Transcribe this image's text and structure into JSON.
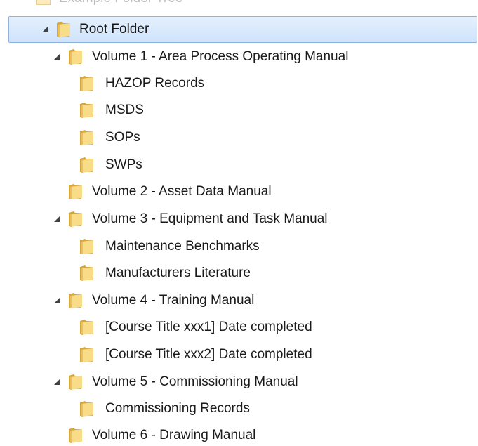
{
  "tree": {
    "partial_top_label": "Example Folder Tree",
    "root": {
      "label": "Root Folder",
      "expanded": true,
      "selected": true
    },
    "nodes": [
      {
        "label": "Volume 1 - Area Process Operating Manual",
        "depth": 1,
        "expanded": true
      },
      {
        "label": "HAZOP Records",
        "depth": 2
      },
      {
        "label": "MSDS",
        "depth": 2
      },
      {
        "label": "SOPs",
        "depth": 2
      },
      {
        "label": "SWPs",
        "depth": 2
      },
      {
        "label": "Volume 2 - Asset Data Manual",
        "depth": 1
      },
      {
        "label": "Volume 3 - Equipment and Task Manual",
        "depth": 1,
        "expanded": true
      },
      {
        "label": "Maintenance Benchmarks",
        "depth": 2
      },
      {
        "label": "Manufacturers Literature",
        "depth": 2
      },
      {
        "label": "Volume 4 - Training Manual",
        "depth": 1,
        "expanded": true
      },
      {
        "label": "[Course Title xxx1] Date completed",
        "depth": 2
      },
      {
        "label": "[Course Title xxx2] Date completed",
        "depth": 2
      },
      {
        "label": "Volume 5 - Commissioning Manual",
        "depth": 1,
        "expanded": true
      },
      {
        "label": "Commissioning Records",
        "depth": 2
      },
      {
        "label": "Volume 6 - Drawing Manual",
        "depth": 1
      }
    ]
  },
  "icons": {
    "folder": "folder-icon",
    "expander": "expanded-triangle-icon"
  },
  "colors": {
    "selection_bg": "#cfe3fb",
    "selection_border": "#8fb3de",
    "folder_light": "#f8dc88",
    "folder_dark": "#d6a73d",
    "expander": "#404040"
  }
}
